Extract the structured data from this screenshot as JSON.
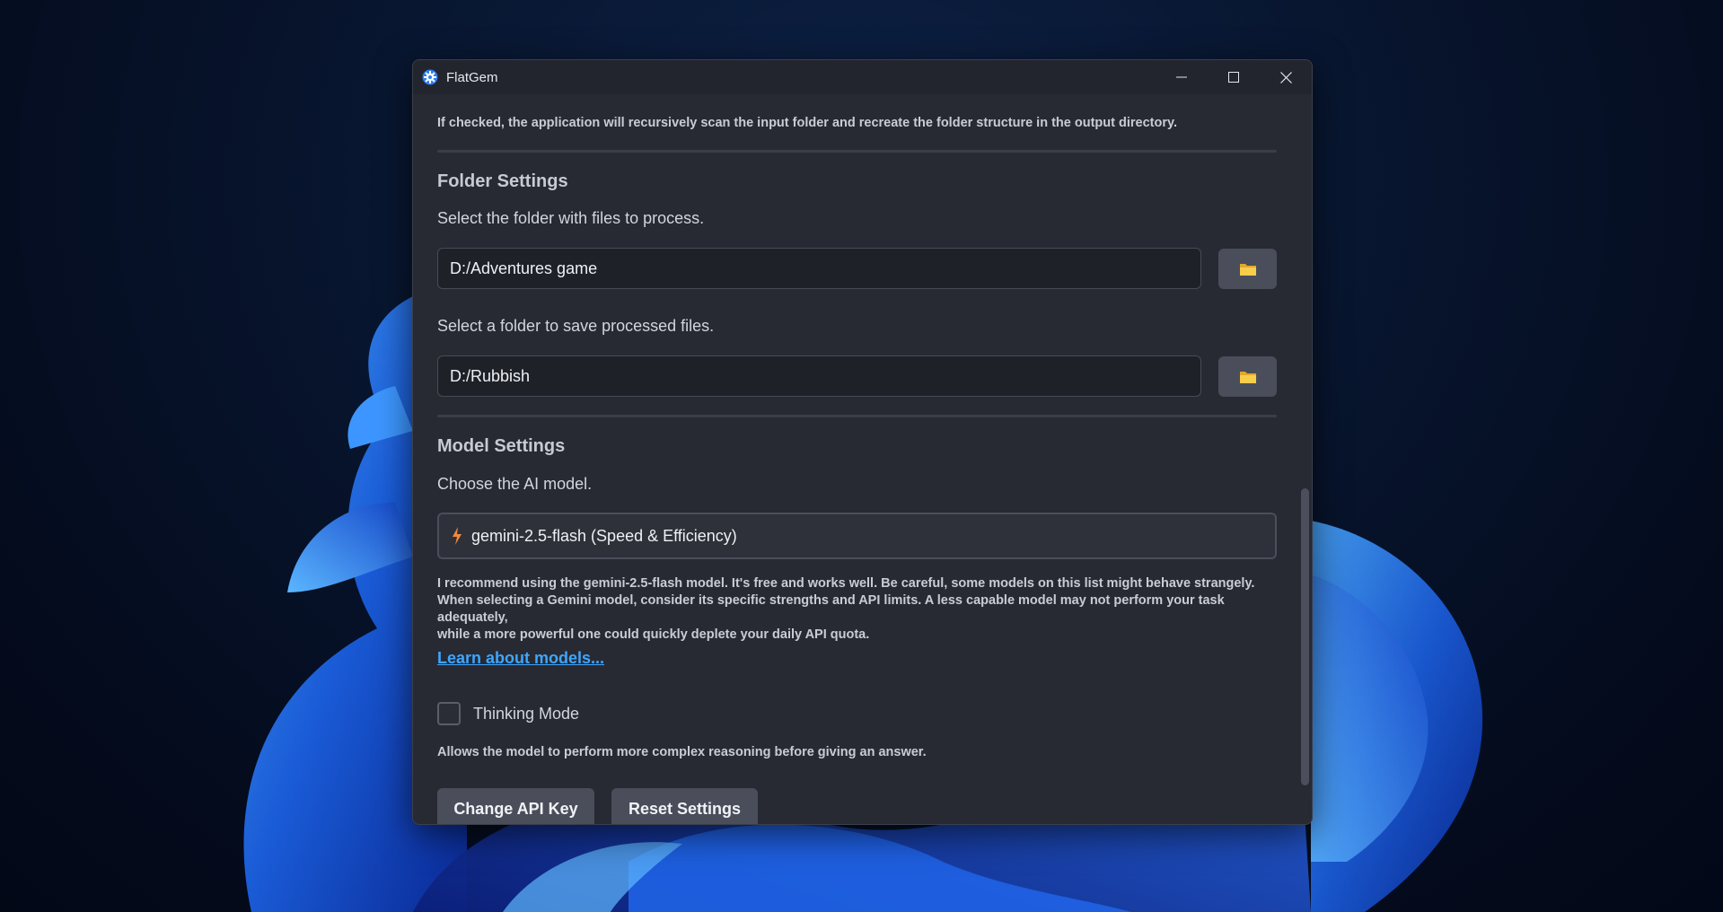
{
  "window": {
    "title": "FlatGem"
  },
  "recursive": {
    "description": "If checked, the application will recursively scan the input folder and recreate the folder structure in the output directory."
  },
  "folder_settings": {
    "title": "Folder Settings",
    "input_label": "Select the folder with files to process.",
    "input_value": "D:/Adventures game",
    "output_label": "Select a folder to save processed files.",
    "output_value": "D:/Rubbish"
  },
  "model_settings": {
    "title": "Model Settings",
    "choose_label": "Choose the AI model.",
    "selected_model": "gemini-2.5-flash (Speed & Efficiency)",
    "desc_line1": "I recommend using the gemini-2.5-flash model. It's free and works well. Be careful, some models on this list might behave strangely.",
    "desc_line2": "When selecting a Gemini model, consider its specific strengths and API limits. A less capable model may not perform your task adequately,",
    "desc_line3": "while a more powerful one could quickly deplete your daily API quota.",
    "learn_link": "Learn about models...",
    "thinking_label": "Thinking Mode",
    "thinking_checked": false,
    "thinking_desc": "Allows the model to perform more complex reasoning before giving an answer."
  },
  "actions": {
    "change_api_key": "Change API Key",
    "reset_settings": "Reset Settings"
  },
  "colors": {
    "accent_link": "#3ea6ff",
    "bolt": "#f08a3c",
    "folder": "#f5c542"
  }
}
